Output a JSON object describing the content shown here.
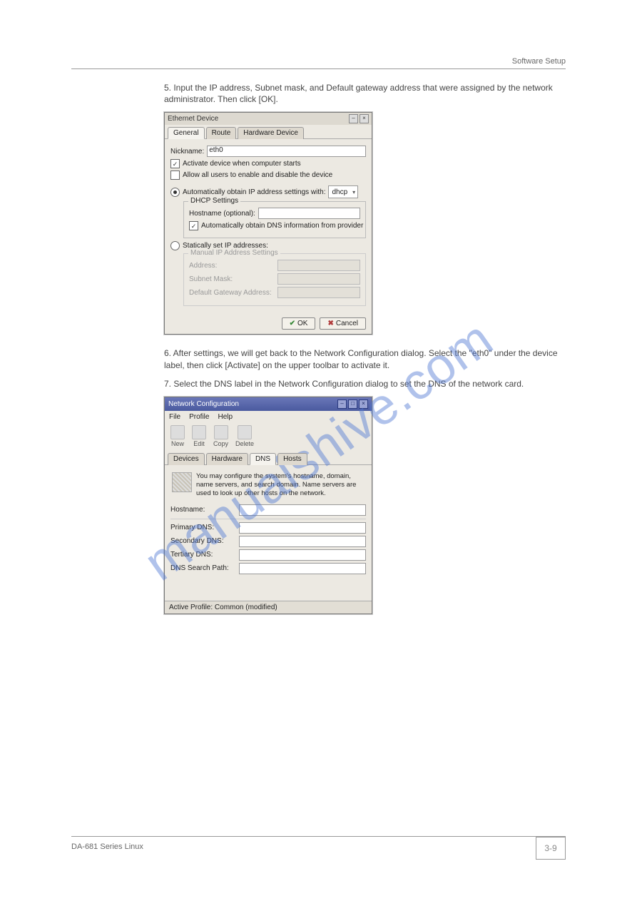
{
  "header": {
    "right": "Software Setup"
  },
  "intro_text": "5. Input the IP address, Subnet mask, and Default gateway address that were assigned by the network administrator. Then click [OK].",
  "watermark": "manualshive.com",
  "dialog1": {
    "title": "Ethernet Device",
    "tabs": [
      "General",
      "Route",
      "Hardware Device"
    ],
    "active_tab": 0,
    "nickname_label": "Nickname:",
    "nickname_value": "eth0",
    "chk_activate": "Activate device when computer starts",
    "chk_allusers": "Allow all users to enable and disable the device",
    "radio_auto": "Automatically obtain IP address settings with:",
    "dhcp_value": "dhcp",
    "dhcp_group_title": "DHCP Settings",
    "hostname_label": "Hostname (optional):",
    "chk_autodns": "Automatically obtain DNS information from provider",
    "radio_static": "Statically set IP addresses:",
    "manual_group_title": "Manual IP Address Settings",
    "address_label": "Address:",
    "subnet_label": "Subnet Mask:",
    "gateway_label": "Default Gateway Address:",
    "ok": "OK",
    "cancel": "Cancel"
  },
  "mid_text_1": "6. After settings, we will get back to the Network Configuration dialog. Select the \"eth0\" under the device label, then click [Activate] on the upper toolbar to activate it.",
  "mid_text_2": "7. Select the DNS label in the Network Configuration dialog to set the DNS of the network card.",
  "dialog2": {
    "title": "Network Configuration",
    "menus": [
      "File",
      "Profile",
      "Help"
    ],
    "toolbar": [
      {
        "label": "New"
      },
      {
        "label": "Edit"
      },
      {
        "label": "Copy"
      },
      {
        "label": "Delete"
      }
    ],
    "tabs": [
      "Devices",
      "Hardware",
      "DNS",
      "Hosts"
    ],
    "active_tab": 2,
    "info_text": "You may configure the system's hostname, domain, name servers, and search domain. Name servers are used to look up other hosts on the network.",
    "hostname_label": "Hostname:",
    "primary_dns": "Primary DNS:",
    "secondary_dns": "Secondary DNS:",
    "tertiary_dns": "Tertiary DNS:",
    "search_path": "DNS Search Path:",
    "statusbar": "Active Profile: Common (modified)"
  },
  "footer": {
    "text": "DA-681 Series Linux",
    "page": "3-9"
  }
}
